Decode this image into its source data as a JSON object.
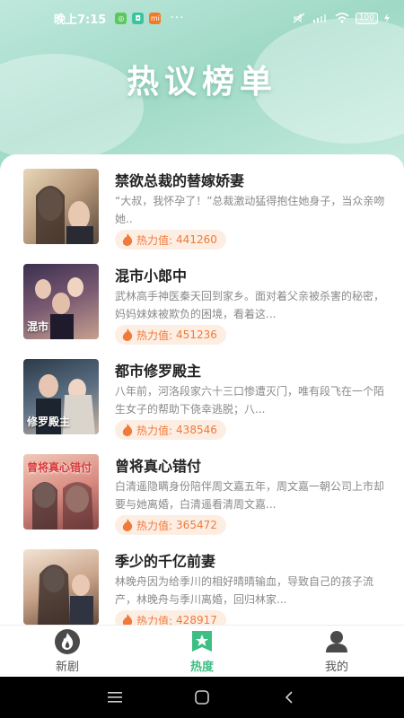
{
  "status_bar": {
    "time": "晚上7:15",
    "app_badges": [
      "◎",
      "◘",
      "mi"
    ],
    "more": "···",
    "battery": "100"
  },
  "header": {
    "title": "热议榜单"
  },
  "colors": {
    "accent": "#3dbe84",
    "heat_text": "#f07a3a",
    "heat_bg": "#fdeee4"
  },
  "heat_label": "热力值: ",
  "items": [
    {
      "title": "禁欲总裁的替嫁娇妻",
      "desc": "“大叔，我怀孕了！”总裁激动猛得抱住她身子，当众亲吻她..",
      "heat": "441260",
      "cover_text": ""
    },
    {
      "title": "混市小郎中",
      "desc": "武林高手神医秦天回到家乡。面对着父亲被杀害的秘密，妈妈妹妹被欺负的困境，看着这...",
      "heat": "451236",
      "cover_text": "混市"
    },
    {
      "title": "都市修罗殿主",
      "desc": "八年前，河洛段家六十三口惨遭灭门，唯有段飞在一个陌生女子的帮助下侥幸逃脱；八...",
      "heat": "438546",
      "cover_text": "修罗殿主"
    },
    {
      "title": "曾将真心错付",
      "desc": "白清遥隐瞒身份陪伴周文嘉五年，周文嘉一朝公司上市却要与她离婚，白清遥看清周文嘉...",
      "heat": "365472",
      "cover_text": "曾将真心错付"
    },
    {
      "title": "季少的千亿前妻",
      "desc": "林晚舟因为给季川的相好晴晴输血，导致自己的孩子流产，林晚舟与季川离婚，回归林家...",
      "heat": "428917",
      "cover_text": ""
    }
  ],
  "tabs": [
    {
      "label": "新剧",
      "icon": "flame-icon"
    },
    {
      "label": "热度",
      "icon": "star-bookmark-icon"
    },
    {
      "label": "我的",
      "icon": "person-icon"
    }
  ]
}
